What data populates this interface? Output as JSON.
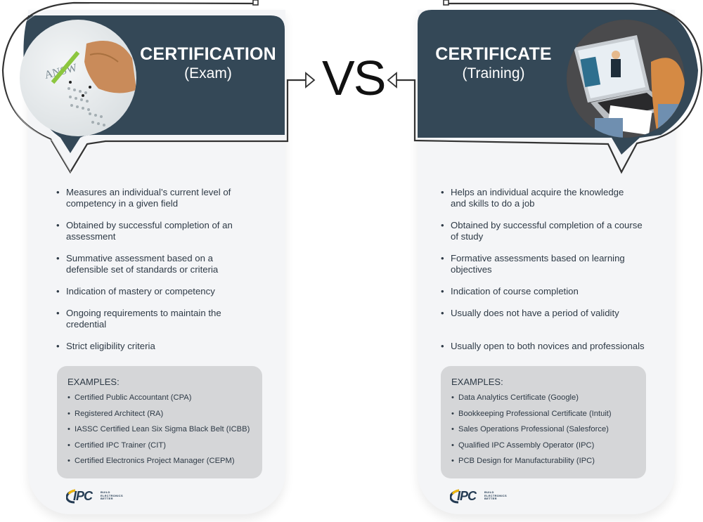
{
  "vs_label": "VS",
  "colors": {
    "header": "#344857",
    "card_bg": "#f4f5f7",
    "examples_bg": "#d5d6d8",
    "text": "#2e3a46",
    "logo_navy": "#243b53",
    "logo_gold": "#f2b705"
  },
  "left": {
    "title": "CERTIFICATION",
    "subtitle": "(Exam)",
    "photo_icon": "exam-answer-sheet-photo",
    "bullets": [
      "Measures an individual’s current  level of competency in a given field",
      "Obtained by successful completion of an assessment",
      "Summative assessment based on a defensible set of standards or criteria",
      "Indication of mastery or competency",
      "Ongoing requirements to maintain the credential",
      "Strict eligibility criteria"
    ],
    "examples_title": "EXAMPLES:",
    "examples": [
      "Certified Public Accountant (CPA)",
      "Registered Architect (RA)",
      "IASSC Certified Lean Six Sigma Black Belt (ICBB)",
      "Certified IPC Trainer (CIT)",
      "Certified Electronics Project Manager (CEPM)"
    ]
  },
  "right": {
    "title": "CERTIFICATE",
    "subtitle": "(Training)",
    "photo_icon": "online-training-laptop-photo",
    "bullets": [
      "Helps an individual acquire the knowledge and skills to do a job",
      "Obtained by successful completion of a course of study",
      "Formative assessments based on learning objectives",
      "Indication of course completion",
      "Usually does not have a period of validity",
      "Usually open to both novices and professionals"
    ],
    "examples_title": "EXAMPLES:",
    "examples": [
      "Data Analytics Certificate (Google)",
      "Bookkeeping Professional Certificate (Intuit)",
      "Sales Operations Professional (Salesforce)",
      "Qualified IPC Assembly Operator (IPC)",
      "PCB Design for Manufacturability (IPC)"
    ]
  },
  "logo": {
    "name": "IPC",
    "tagline": [
      "BUILD",
      "ELECTRONICS",
      "BETTER"
    ]
  }
}
